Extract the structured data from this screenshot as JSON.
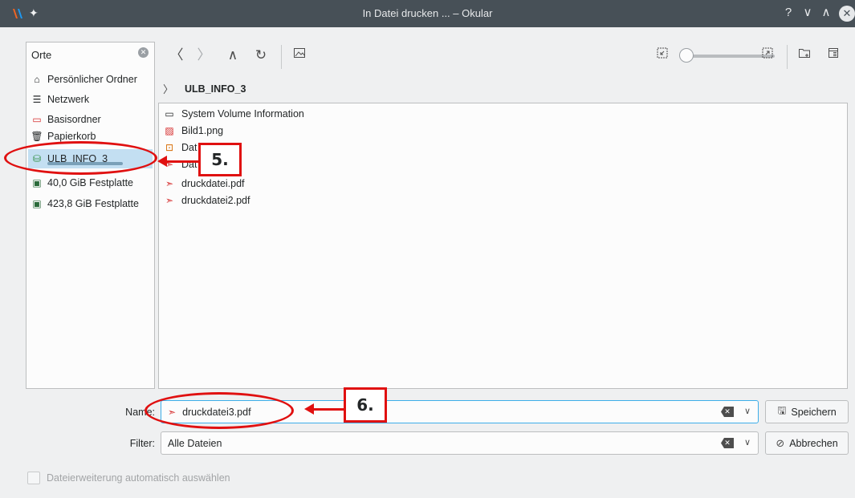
{
  "window": {
    "title": "In Datei drucken ... – Okular",
    "help_glyph": "?",
    "minimize_glyph": "∨",
    "maximize_glyph": "∧",
    "close_glyph": "✕"
  },
  "sidebar": {
    "header": "Orte",
    "items": [
      {
        "label": "Persönlicher Ordner",
        "icon": "home-icon"
      },
      {
        "label": "Netzwerk",
        "icon": "network-icon"
      },
      {
        "label": "Basisordner",
        "icon": "root-folder-icon"
      },
      {
        "label": "Papierkorb",
        "icon": "trash-icon"
      },
      {
        "label": "ULB_INFO_3",
        "icon": "usb-drive-icon",
        "selected": true
      },
      {
        "label": "40,0 GiB Festplatte",
        "icon": "harddisk-icon"
      },
      {
        "label": "423,8 GiB Festplatte",
        "icon": "harddisk-icon"
      }
    ]
  },
  "toolbar": {
    "back": "〈",
    "forward": "〉",
    "up": "∧",
    "reload": "↻",
    "preview": "🖼"
  },
  "breadcrumb": {
    "chevron": "〉",
    "current": "ULB_INFO_3"
  },
  "files": [
    {
      "name": "System Volume Information",
      "type": "folder"
    },
    {
      "name": "Bild1.png",
      "type": "image"
    },
    {
      "name": "Dat",
      "type": "presentation"
    },
    {
      "name": "Dat",
      "type": "pdf"
    },
    {
      "name": "druckdatei.pdf",
      "type": "pdf"
    },
    {
      "name": "druckdatei2.pdf",
      "type": "pdf"
    }
  ],
  "form": {
    "name_label": "Name:",
    "name_value": "druckdatei3.pdf",
    "filter_label": "Filter:",
    "filter_value": "Alle Dateien",
    "save_label": "Speichern",
    "cancel_label": "Abbrechen",
    "auto_ext_label": "Dateierweiterung automatisch auswählen"
  },
  "annotations": {
    "step5": "5.",
    "step6": "6."
  },
  "colors": {
    "titlebar": "#475057",
    "selection": "#c3dff2",
    "annotation": "#e01010",
    "focus": "#3daee9"
  }
}
